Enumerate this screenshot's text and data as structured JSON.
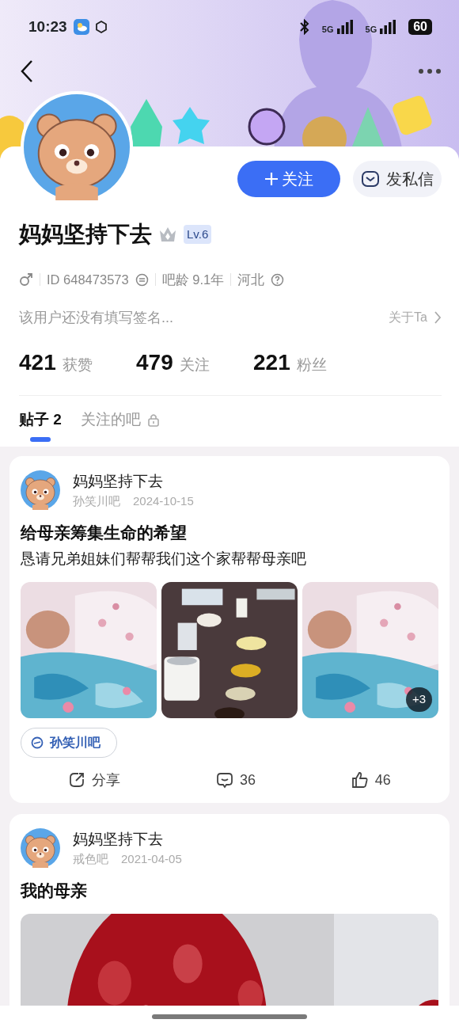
{
  "status_bar": {
    "time": "10:23",
    "network_1": "5G",
    "network_2": "5G",
    "battery": "60"
  },
  "profile": {
    "name": "妈妈坚持下去",
    "level": "Lv.6",
    "gender": {
      "kind": "male"
    },
    "id": "ID 648473573",
    "age": "吧龄 9.1年",
    "region": "河北",
    "signature": "该用户还没有填写签名...",
    "about": "关于Ta"
  },
  "actions": {
    "follow": "关注",
    "message": "发私信"
  },
  "stats": [
    {
      "value": "421",
      "label": "获赞"
    },
    {
      "value": "479",
      "label": "关注"
    },
    {
      "value": "221",
      "label": "粉丝"
    }
  ],
  "tabs": [
    {
      "label": "贴子 2",
      "selected": true,
      "locked": false
    },
    {
      "label": "关注的吧",
      "selected": false,
      "locked": true
    }
  ],
  "posts": [
    {
      "author": "妈妈坚持下去",
      "forum": "孙笑川吧",
      "date": "2024-10-15",
      "title": "给母亲筹集生命的希望",
      "body": "恳请兄弟姐妹们帮帮我们这个家帮帮母亲吧",
      "images": [
        {
          "kind": "bed"
        },
        {
          "kind": "table"
        },
        {
          "kind": "bed"
        }
      ],
      "more": "+3",
      "tag": "孙笑川吧",
      "share": "分享",
      "comments": "36",
      "likes": "46"
    },
    {
      "author": "妈妈坚持下去",
      "forum": "戒色吧",
      "date": "2021-04-05",
      "title": "我的母亲",
      "images": [
        {
          "kind": "papercut"
        }
      ]
    }
  ]
}
